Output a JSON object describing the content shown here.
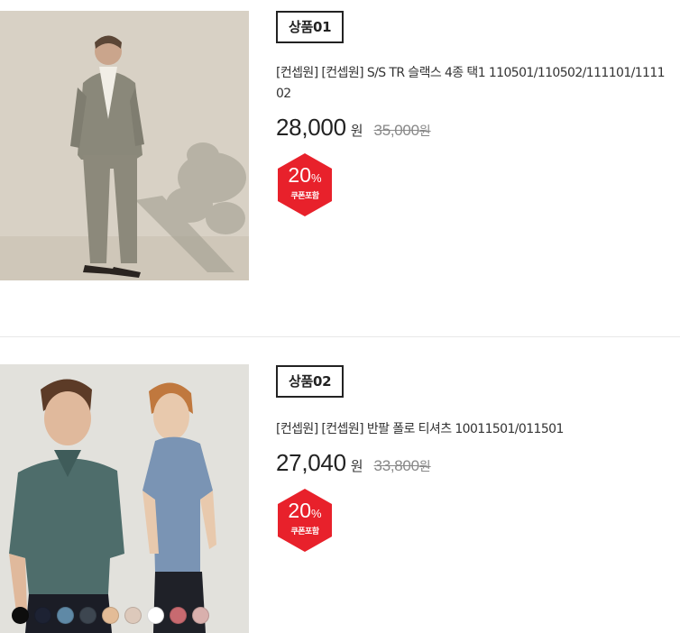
{
  "products": [
    {
      "tag": "상품01",
      "title": "[컨셉원] [컨셉원] S/S TR 슬랙스 4종 택1 110501/110502/111101/111102",
      "price": "28,000",
      "currency": "원",
      "original_price": "35,000",
      "original_currency": "원",
      "discount": "20",
      "discount_unit": "%",
      "coupon_label": "쿠폰포함",
      "badge_color": "#e8212b"
    },
    {
      "tag": "상품02",
      "title": "[컨셉원] [컨셉원] 반팔 폴로 티셔츠 10011501/011501",
      "price": "27,040",
      "currency": "원",
      "original_price": "33,800",
      "original_currency": "원",
      "discount": "20",
      "discount_unit": "%",
      "coupon_label": "쿠폰포함",
      "badge_color": "#e8212b",
      "swatches": [
        "#0d0d0d",
        "#1d2233",
        "#5f89a6",
        "#3d4650",
        "#e3bc97",
        "#ddc9bb",
        "#ffffff",
        "#c86a70",
        "#d9b0ad"
      ]
    }
  ]
}
